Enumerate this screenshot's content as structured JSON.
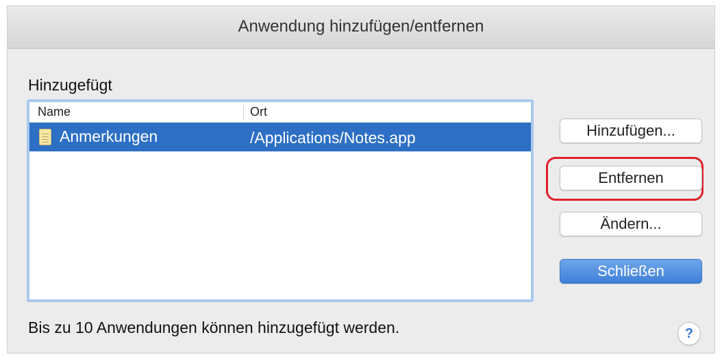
{
  "window": {
    "title": "Anwendung hinzufügen/entfernen"
  },
  "list": {
    "section_label": "Hinzugefügt",
    "columns": {
      "name": "Name",
      "location": "Ort"
    },
    "rows": [
      {
        "name": "Anmerkungen",
        "path": "/Applications/Notes.app",
        "icon": "notes-icon",
        "selected": true
      }
    ]
  },
  "buttons": {
    "add": "Hinzufügen...",
    "remove": "Entfernen",
    "change": "Ändern...",
    "close": "Schließen",
    "help": "?"
  },
  "footer": {
    "note": "Bis zu 10 Anwendungen können hinzugefügt werden."
  },
  "colors": {
    "selection": "#2d6fc4",
    "list_focus_ring": "#a8c8ee",
    "default_button": "#3e7fd8",
    "highlight_ring": "#e0202a"
  }
}
